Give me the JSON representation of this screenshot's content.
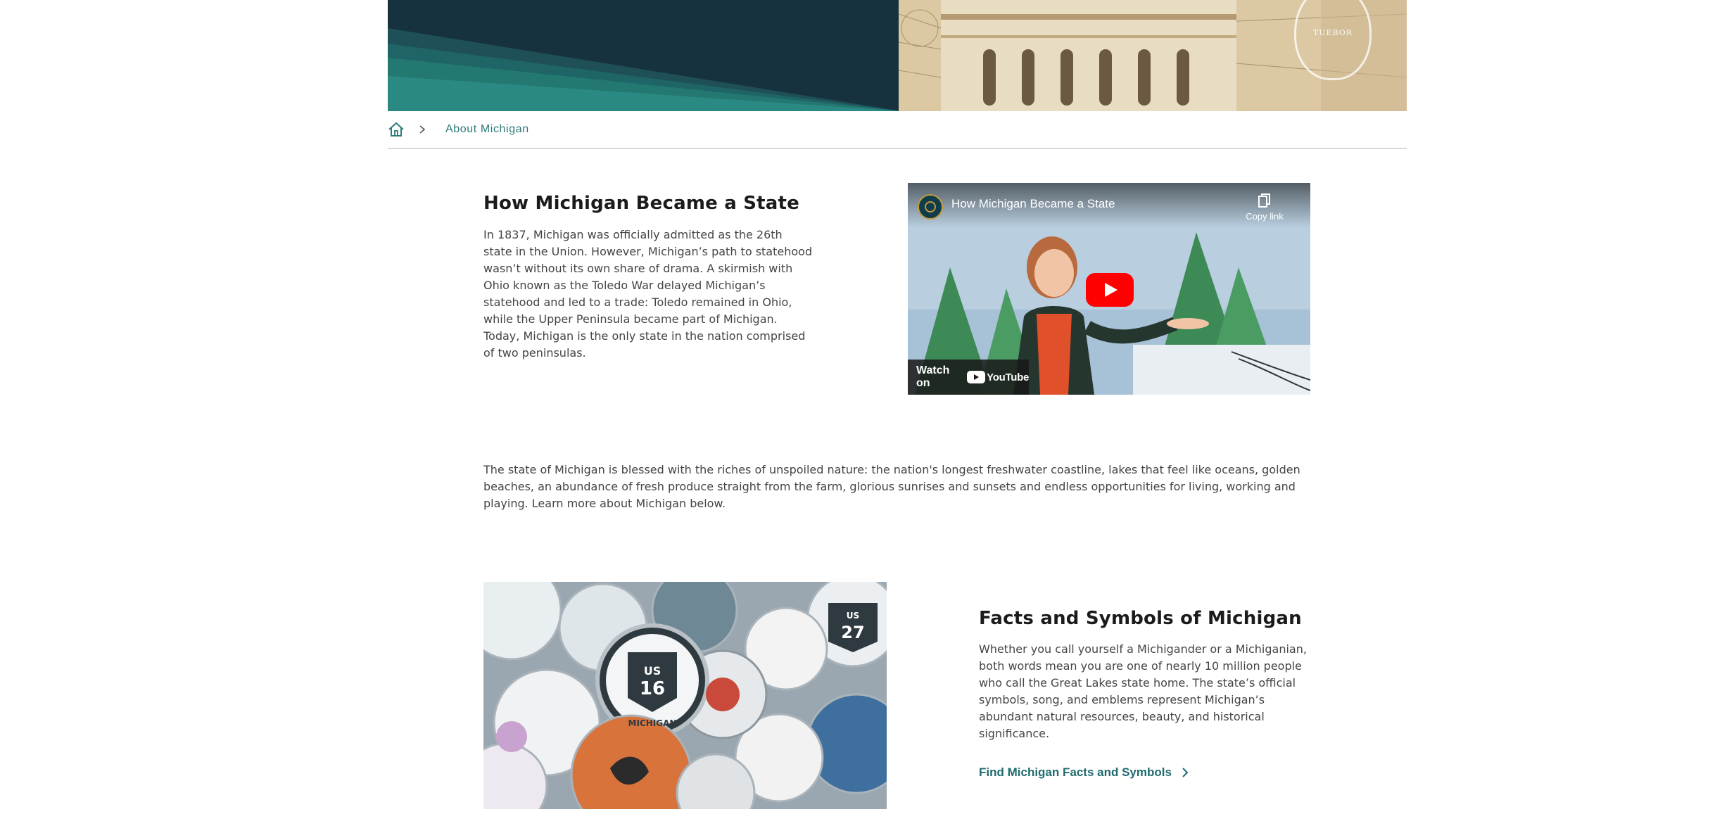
{
  "breadcrumb": {
    "home_icon": "home-icon",
    "separator_icon": "chevron-right-icon",
    "current": "About Michigan"
  },
  "section_state": {
    "title": "How Michigan Became a State",
    "body": "In 1837, Michigan was officially admitted as the 26th state in the Union. However, Michigan’s path to statehood wasn’t without its own share of drama. A skirmish with Ohio known as the Toledo War delayed Michigan’s statehood and led to a trade: Toledo remained in Ohio, while the Upper Peninsula became part of Michigan. Today, Michigan is the only state in the nation comprised of two peninsulas."
  },
  "video": {
    "title": "How Michigan Became a State",
    "copy_link": "Copy link",
    "watch_on": "Watch on",
    "youtube": "YouTube",
    "play_icon": "play-icon"
  },
  "intro": {
    "body": "The state of Michigan is blessed with the riches of unspoiled nature: the nation's longest freshwater coastline, lakes that feel like oceans, golden beaches, an abundance of fresh produce straight from the farm, glorious sunrises and sunsets and endless opportunities for living, working and playing. Learn more about Michigan below."
  },
  "section_facts": {
    "title": "Facts and Symbols of Michigan",
    "body": "Whether you call yourself a Michigander or a Michiganian, both words mean you are one of nearly 10 million people who call the Great Lakes state home. The state’s official symbols,  song, and emblems represent Michigan’s abundant natural resources, beauty, and historical significance.",
    "cta": "Find Michigan Facts and Symbols"
  },
  "image_text": {
    "badge_us": "US",
    "badge_16": "16",
    "badge_27": "27",
    "badge_michigan": "MICHIGAN",
    "seal_motto": "TUEBOR"
  },
  "colors": {
    "accent": "#2d7a7a",
    "link": "#1f6b6e",
    "hero_dark": "#17323f",
    "hero_teal": "#2a8a83",
    "youtube_red": "#ff0000"
  }
}
